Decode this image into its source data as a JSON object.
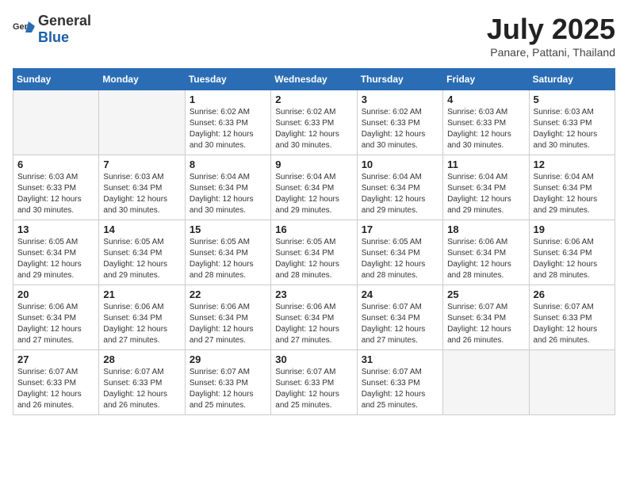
{
  "logo": {
    "text_general": "General",
    "text_blue": "Blue"
  },
  "title": "July 2025",
  "subtitle": "Panare, Pattani, Thailand",
  "weekdays": [
    "Sunday",
    "Monday",
    "Tuesday",
    "Wednesday",
    "Thursday",
    "Friday",
    "Saturday"
  ],
  "weeks": [
    [
      null,
      null,
      {
        "day": "1",
        "sunrise": "6:02 AM",
        "sunset": "6:33 PM",
        "daylight": "12 hours and 30 minutes."
      },
      {
        "day": "2",
        "sunrise": "6:02 AM",
        "sunset": "6:33 PM",
        "daylight": "12 hours and 30 minutes."
      },
      {
        "day": "3",
        "sunrise": "6:02 AM",
        "sunset": "6:33 PM",
        "daylight": "12 hours and 30 minutes."
      },
      {
        "day": "4",
        "sunrise": "6:03 AM",
        "sunset": "6:33 PM",
        "daylight": "12 hours and 30 minutes."
      },
      {
        "day": "5",
        "sunrise": "6:03 AM",
        "sunset": "6:33 PM",
        "daylight": "12 hours and 30 minutes."
      }
    ],
    [
      {
        "day": "6",
        "sunrise": "6:03 AM",
        "sunset": "6:33 PM",
        "daylight": "12 hours and 30 minutes."
      },
      {
        "day": "7",
        "sunrise": "6:03 AM",
        "sunset": "6:34 PM",
        "daylight": "12 hours and 30 minutes."
      },
      {
        "day": "8",
        "sunrise": "6:04 AM",
        "sunset": "6:34 PM",
        "daylight": "12 hours and 30 minutes."
      },
      {
        "day": "9",
        "sunrise": "6:04 AM",
        "sunset": "6:34 PM",
        "daylight": "12 hours and 29 minutes."
      },
      {
        "day": "10",
        "sunrise": "6:04 AM",
        "sunset": "6:34 PM",
        "daylight": "12 hours and 29 minutes."
      },
      {
        "day": "11",
        "sunrise": "6:04 AM",
        "sunset": "6:34 PM",
        "daylight": "12 hours and 29 minutes."
      },
      {
        "day": "12",
        "sunrise": "6:04 AM",
        "sunset": "6:34 PM",
        "daylight": "12 hours and 29 minutes."
      }
    ],
    [
      {
        "day": "13",
        "sunrise": "6:05 AM",
        "sunset": "6:34 PM",
        "daylight": "12 hours and 29 minutes."
      },
      {
        "day": "14",
        "sunrise": "6:05 AM",
        "sunset": "6:34 PM",
        "daylight": "12 hours and 29 minutes."
      },
      {
        "day": "15",
        "sunrise": "6:05 AM",
        "sunset": "6:34 PM",
        "daylight": "12 hours and 28 minutes."
      },
      {
        "day": "16",
        "sunrise": "6:05 AM",
        "sunset": "6:34 PM",
        "daylight": "12 hours and 28 minutes."
      },
      {
        "day": "17",
        "sunrise": "6:05 AM",
        "sunset": "6:34 PM",
        "daylight": "12 hours and 28 minutes."
      },
      {
        "day": "18",
        "sunrise": "6:06 AM",
        "sunset": "6:34 PM",
        "daylight": "12 hours and 28 minutes."
      },
      {
        "day": "19",
        "sunrise": "6:06 AM",
        "sunset": "6:34 PM",
        "daylight": "12 hours and 28 minutes."
      }
    ],
    [
      {
        "day": "20",
        "sunrise": "6:06 AM",
        "sunset": "6:34 PM",
        "daylight": "12 hours and 27 minutes."
      },
      {
        "day": "21",
        "sunrise": "6:06 AM",
        "sunset": "6:34 PM",
        "daylight": "12 hours and 27 minutes."
      },
      {
        "day": "22",
        "sunrise": "6:06 AM",
        "sunset": "6:34 PM",
        "daylight": "12 hours and 27 minutes."
      },
      {
        "day": "23",
        "sunrise": "6:06 AM",
        "sunset": "6:34 PM",
        "daylight": "12 hours and 27 minutes."
      },
      {
        "day": "24",
        "sunrise": "6:07 AM",
        "sunset": "6:34 PM",
        "daylight": "12 hours and 27 minutes."
      },
      {
        "day": "25",
        "sunrise": "6:07 AM",
        "sunset": "6:34 PM",
        "daylight": "12 hours and 26 minutes."
      },
      {
        "day": "26",
        "sunrise": "6:07 AM",
        "sunset": "6:33 PM",
        "daylight": "12 hours and 26 minutes."
      }
    ],
    [
      {
        "day": "27",
        "sunrise": "6:07 AM",
        "sunset": "6:33 PM",
        "daylight": "12 hours and 26 minutes."
      },
      {
        "day": "28",
        "sunrise": "6:07 AM",
        "sunset": "6:33 PM",
        "daylight": "12 hours and 26 minutes."
      },
      {
        "day": "29",
        "sunrise": "6:07 AM",
        "sunset": "6:33 PM",
        "daylight": "12 hours and 25 minutes."
      },
      {
        "day": "30",
        "sunrise": "6:07 AM",
        "sunset": "6:33 PM",
        "daylight": "12 hours and 25 minutes."
      },
      {
        "day": "31",
        "sunrise": "6:07 AM",
        "sunset": "6:33 PM",
        "daylight": "12 hours and 25 minutes."
      },
      null,
      null
    ]
  ]
}
